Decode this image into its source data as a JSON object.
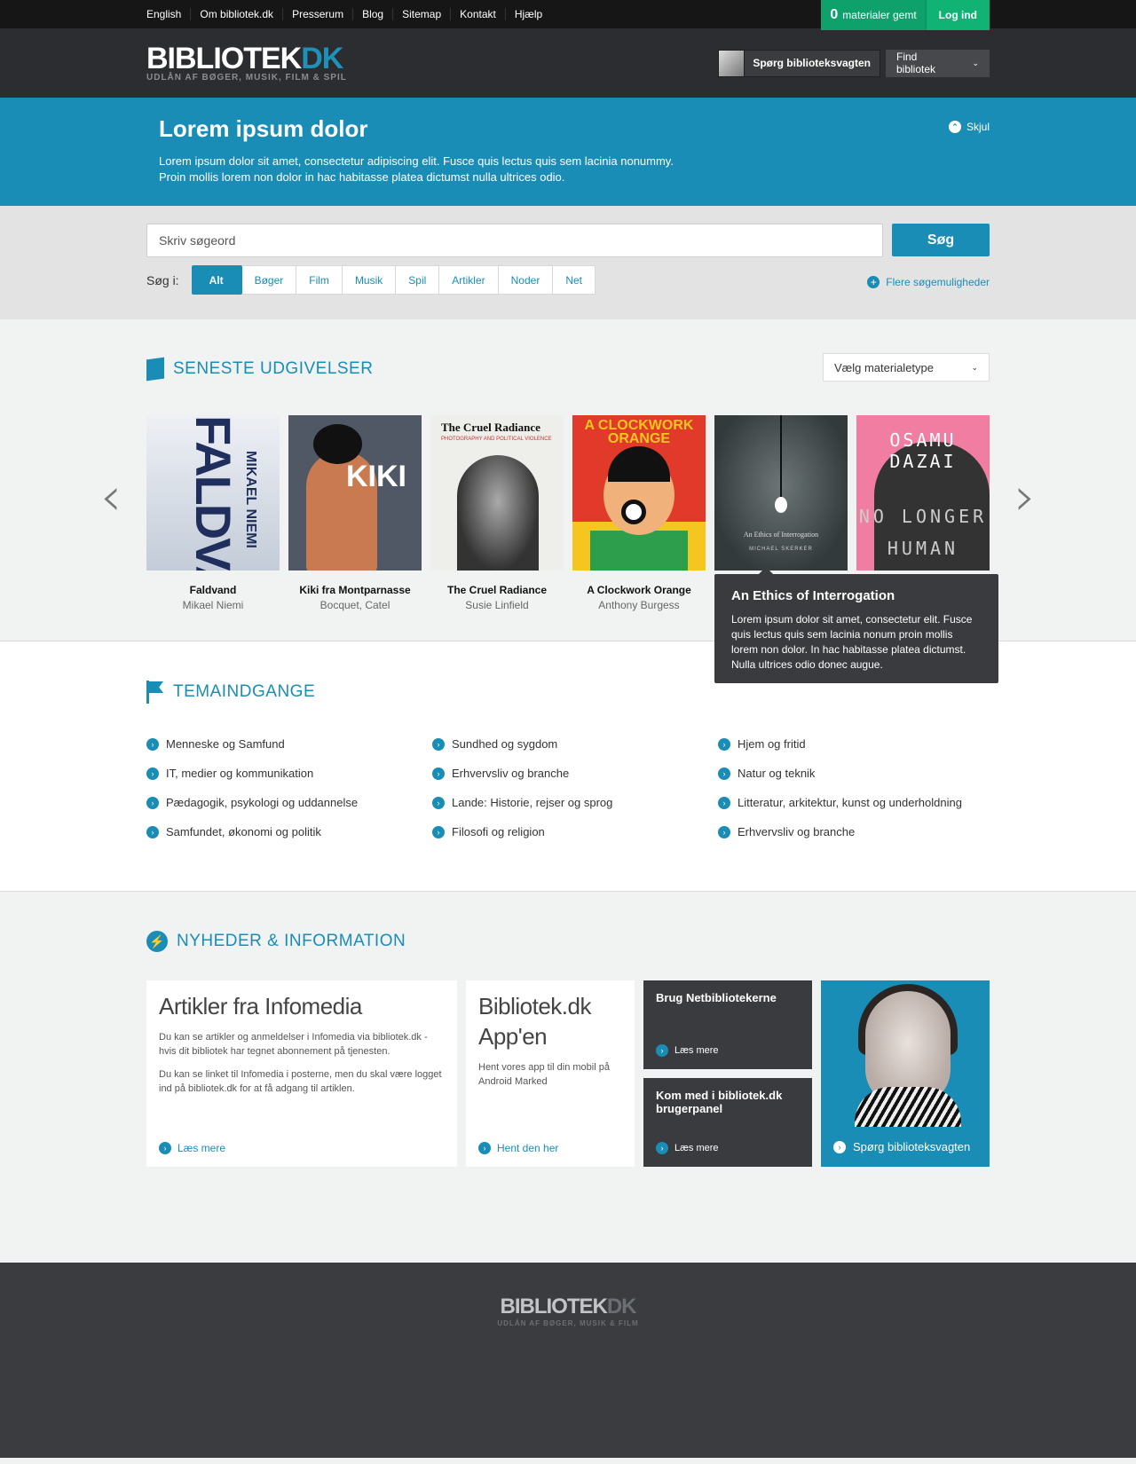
{
  "topnav": {
    "links": [
      "English",
      "Om bibliotek.dk",
      "Presserum",
      "Blog",
      "Sitemap",
      "Kontakt",
      "Hjælp"
    ],
    "saved_count": "0",
    "saved_label": "materialer gemt",
    "login_label": "Log ind"
  },
  "header": {
    "logo_main": "BIBLIOTEK",
    "logo_accent": "DK",
    "logo_tagline": "UDLÅN AF BØGER, MUSIK, FILM & SPIL",
    "ask_label": "Spørg biblioteksvagten",
    "find_library_label": "Find bibliotek"
  },
  "banner": {
    "title": "Lorem ipsum dolor",
    "text_line1": "Lorem ipsum dolor sit amet, consectetur adipiscing elit. Fusce quis lectus quis sem lacinia nonummy.",
    "text_line2": "Proin mollis lorem non dolor in hac habitasse platea dictumst nulla ultrices odio.",
    "hide_label": "Skjul"
  },
  "search": {
    "placeholder": "Skriv søgeord",
    "button_label": "Søg",
    "scope_label": "Søg i:",
    "tabs": [
      "Alt",
      "Bøger",
      "Film",
      "Musik",
      "Spil",
      "Artikler",
      "Noder",
      "Net"
    ],
    "active_tab": "Alt",
    "more_options_label": "Flere søgemuligheder"
  },
  "latest": {
    "heading": "SENESTE UDGIVELSER",
    "material_type_label": "Vælg materialetype",
    "books": [
      {
        "title": "Faldvand",
        "author": "Mikael Niemi",
        "cover_text": "FALDVAND",
        "cover_author": "MIKAEL NIEMI"
      },
      {
        "title": "Kiki fra Montparnasse",
        "author": "Bocquet, Catel",
        "cover_text": "KIKI"
      },
      {
        "title": "The Cruel Radiance",
        "author": "Susie Linfield",
        "cover_text": "The Cruel Radiance",
        "cover_sub": "PHOTOGRAPHY AND POLITICAL VIOLENCE"
      },
      {
        "title": "A Clockwork Orange",
        "author": "Anthony Burgess",
        "cover_text": "A CLOCKWORK ORANGE"
      },
      {
        "title": "An Ethics of Interrogation",
        "author": "Michael Skerker",
        "cover_text": "An Ethics of Interrogation",
        "cover_author": "MICHAEL SKERKER"
      },
      {
        "title": "No Longer Human",
        "author": "Osamu Dazai",
        "cover_text_top": "OSAMU DAZAI",
        "cover_text": "NO LONGER HUMAN"
      }
    ],
    "tooltip": {
      "title": "An Ethics of Interrogation",
      "text": "Lorem ipsum dolor sit amet, consectetur elit. Fusce quis lectus quis sem lacinia nonum proin mollis lorem non dolor. In hac habitasse platea dictumst. Nulla ultrices odio donec augue."
    }
  },
  "themes": {
    "heading": "TEMAINDGANGE",
    "columns": [
      [
        "Menneske og Samfund",
        "IT, medier og kommunikation",
        "Pædagogik, psykologi og uddannelse",
        "Samfundet, økonomi og politik"
      ],
      [
        "Sundhed og sygdom",
        "Erhvervsliv og branche",
        "Lande: Historie, rejser og sprog",
        "Filosofi og religion"
      ],
      [
        "Hjem og fritid",
        "Natur og teknik",
        "Litteratur, arkitektur, kunst og underholdning",
        "Erhvervsliv og branche"
      ]
    ]
  },
  "news": {
    "heading": "NYHEDER & INFORMATION",
    "infomedia": {
      "title": "Artikler fra Infomedia",
      "p1": "Du kan se artikler og anmeldelser i Infomedia via bibliotek.dk - hvis dit bibliotek har tegnet abonnement på tjenesten.",
      "p2": "Du kan se linket til Infomedia i posterne, men du skal være logget ind på bibliotek.dk for at få adgang til artiklen.",
      "link": "Læs mere"
    },
    "app": {
      "title": "Bibliotek.dk App'en",
      "text": "Hent vores app til din mobil på Android Marked",
      "link": "Hent den her"
    },
    "netlib": {
      "title": "Brug Netbibliotekerne",
      "link": "Læs mere"
    },
    "panel": {
      "title": "Kom med i bibliotek.dk brugerpanel",
      "link": "Læs mere"
    },
    "ask": {
      "label": "Spørg biblioteksvagten"
    }
  },
  "footer": {
    "logo_main": "BIBLIOTEK",
    "logo_accent": "DK",
    "tagline": "UDLÅN AF BØGER, MUSIK & FILM"
  },
  "colors": {
    "accent": "#1a8db6",
    "dark": "#2c2d30",
    "green": "#11b374"
  }
}
